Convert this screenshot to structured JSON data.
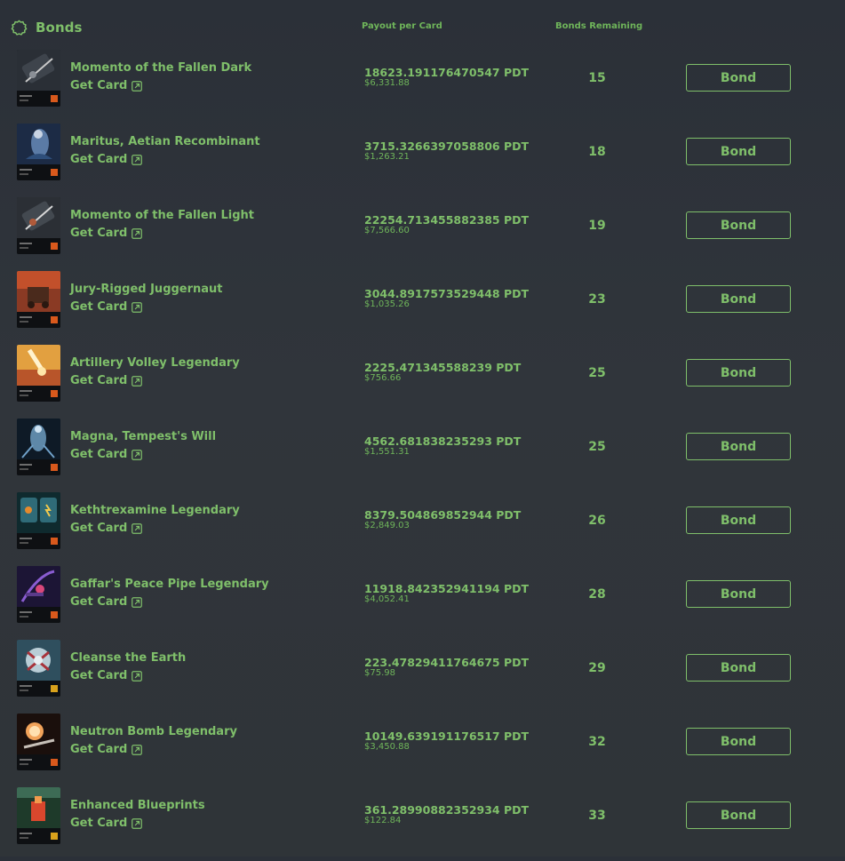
{
  "header": {
    "title": "Bonds",
    "title_icon": "gear-outline-icon",
    "col_payout": "Payout per Card",
    "col_remaining": "Bonds Remaining"
  },
  "colors": {
    "accent": "#7fbf6a",
    "background": "#2f343a"
  },
  "rows": [
    {
      "name": "Momento of the Fallen Dark",
      "get_card": "Get Card",
      "pdt": "18623.191176470547 PDT",
      "usd": "$6,331.88",
      "remaining": "15",
      "button": "Bond"
    },
    {
      "name": "Maritus, Aetian Recombinant",
      "get_card": "Get Card",
      "pdt": "3715.3266397058806 PDT",
      "usd": "$1,263.21",
      "remaining": "18",
      "button": "Bond"
    },
    {
      "name": "Momento of the Fallen Light",
      "get_card": "Get Card",
      "pdt": "22254.713455882385 PDT",
      "usd": "$7,566.60",
      "remaining": "19",
      "button": "Bond"
    },
    {
      "name": "Jury-Rigged Juggernaut",
      "get_card": "Get Card",
      "pdt": "3044.8917573529448 PDT",
      "usd": "$1,035.26",
      "remaining": "23",
      "button": "Bond"
    },
    {
      "name": "Artillery Volley Legendary",
      "get_card": "Get Card",
      "pdt": "2225.471345588239 PDT",
      "usd": "$756.66",
      "remaining": "25",
      "button": "Bond"
    },
    {
      "name": "Magna, Tempest's Will",
      "get_card": "Get Card",
      "pdt": "4562.681838235293 PDT",
      "usd": "$1,551.31",
      "remaining": "25",
      "button": "Bond"
    },
    {
      "name": "Kethtrexamine Legendary",
      "get_card": "Get Card",
      "pdt": "8379.504869852944 PDT",
      "usd": "$2,849.03",
      "remaining": "26",
      "button": "Bond"
    },
    {
      "name": "Gaffar's Peace Pipe Legendary",
      "get_card": "Get Card",
      "pdt": "11918.842352941194 PDT",
      "usd": "$4,052.41",
      "remaining": "28",
      "button": "Bond"
    },
    {
      "name": "Cleanse the Earth",
      "get_card": "Get Card",
      "pdt": "223.47829411764675 PDT",
      "usd": "$75.98",
      "remaining": "29",
      "button": "Bond"
    },
    {
      "name": "Neutron Bomb Legendary",
      "get_card": "Get Card",
      "pdt": "10149.639191176517 PDT",
      "usd": "$3,450.88",
      "remaining": "32",
      "button": "Bond"
    },
    {
      "name": "Enhanced Blueprints",
      "get_card": "Get Card",
      "pdt": "361.28990882352934 PDT",
      "usd": "$122.84",
      "remaining": "33",
      "button": "Bond"
    }
  ]
}
